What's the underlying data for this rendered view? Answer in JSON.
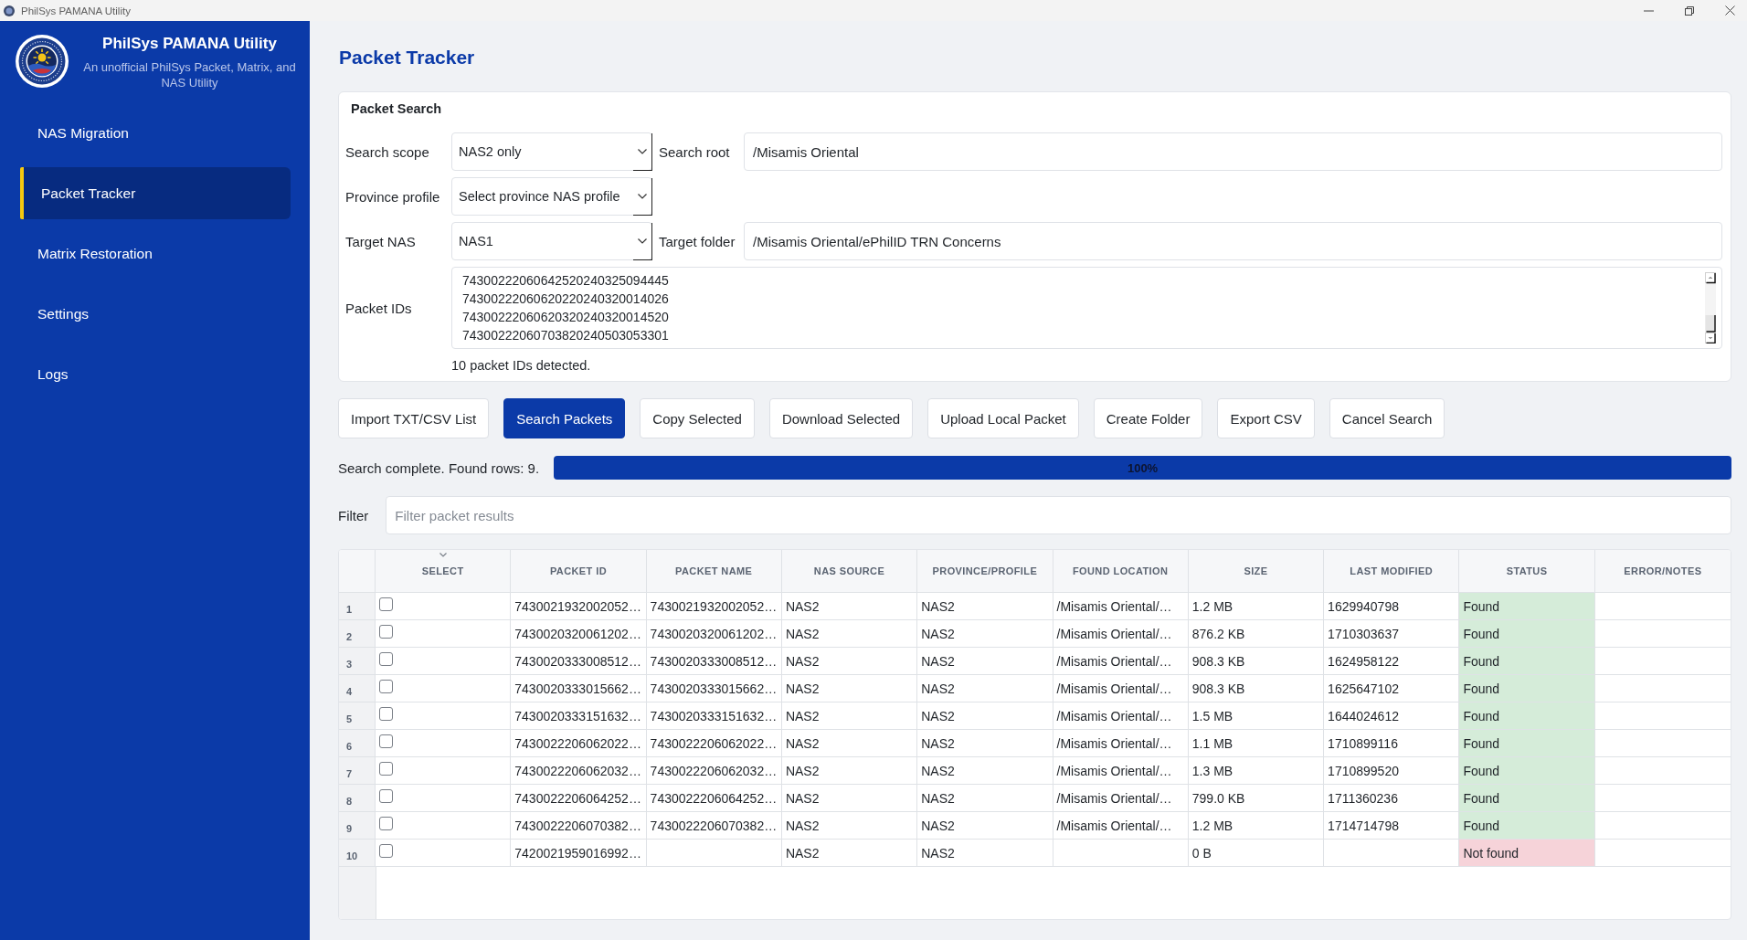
{
  "window": {
    "title": "PhilSys PAMANA Utility"
  },
  "sidebar": {
    "app_name": "PhilSys PAMANA Utility",
    "tagline": "An unofficial PhilSys Packet, Matrix, and NAS Utility",
    "items": [
      {
        "label": "NAS Migration",
        "selected": false
      },
      {
        "label": "Packet Tracker",
        "selected": true
      },
      {
        "label": "Matrix Restoration",
        "selected": false
      },
      {
        "label": "Settings",
        "selected": false
      },
      {
        "label": "Logs",
        "selected": false
      }
    ]
  },
  "page_title": "Packet Tracker",
  "packet_search": {
    "title": "Packet Search",
    "search_scope": {
      "label": "Search scope",
      "value": "NAS2 only"
    },
    "search_root": {
      "label": "Search root",
      "value": "/Misamis Oriental"
    },
    "province_profile": {
      "label": "Province profile",
      "value": "Select province NAS profile"
    },
    "target_nas": {
      "label": "Target NAS",
      "value": "NAS1"
    },
    "target_folder": {
      "label": "Target folder",
      "value": "/Misamis Oriental/ePhilID TRN Concerns"
    },
    "packet_ids": {
      "label": "Packet IDs",
      "lines": [
        "74300222060642520240325094445",
        "74300222060620220240320014026",
        "74300222060620320240320014520",
        "74300222060703820240503053301"
      ]
    },
    "detected_note": "10 packet IDs detected."
  },
  "actions": [
    {
      "label": "Import TXT/CSV List",
      "primary": false
    },
    {
      "label": "Search Packets",
      "primary": true
    },
    {
      "label": "Copy Selected",
      "primary": false
    },
    {
      "label": "Download Selected",
      "primary": false
    },
    {
      "label": "Upload Local Packet",
      "primary": false
    },
    {
      "label": "Create Folder",
      "primary": false
    },
    {
      "label": "Export CSV",
      "primary": false
    },
    {
      "label": "Cancel Search",
      "primary": false
    }
  ],
  "progress": {
    "message": "Search complete. Found rows: 9.",
    "level": 1,
    "label": "100%"
  },
  "filter": {
    "label": "Filter",
    "placeholder": "Filter packet results"
  },
  "results_table": {
    "columns": [
      {
        "label": "SELECT",
        "sorted": true
      },
      {
        "label": "PACKET ID",
        "sorted": false
      },
      {
        "label": "PACKET NAME",
        "sorted": false
      },
      {
        "label": "NAS SOURCE",
        "sorted": false
      },
      {
        "label": "PROVINCE/PROFILE",
        "sorted": false
      },
      {
        "label": "FOUND LOCATION",
        "sorted": false
      },
      {
        "label": "SIZE",
        "sorted": false
      },
      {
        "label": "LAST MODIFIED",
        "sorted": false
      },
      {
        "label": "STATUS",
        "sorted": false
      },
      {
        "label": "ERROR/NOTES",
        "sorted": false
      }
    ],
    "rows": [
      {
        "number": "1",
        "checked": false,
        "packet_id": "7430021932002052…",
        "packet_name": "7430021932002052…",
        "nas_source": "NAS2",
        "province_profile": "NAS2",
        "found_location": "/Misamis Oriental/…",
        "size": "1.2 MB",
        "last_modified": "1629940798",
        "status": {
          "text": "Found",
          "color": "#d5ecd9"
        }
      },
      {
        "number": "2",
        "checked": false,
        "packet_id": "7430020320061202…",
        "packet_name": "7430020320061202…",
        "nas_source": "NAS2",
        "province_profile": "NAS2",
        "found_location": "/Misamis Oriental/…",
        "size": "876.2 KB",
        "last_modified": "1710303637",
        "status": {
          "text": "Found",
          "color": "#d5ecd9"
        }
      },
      {
        "number": "3",
        "checked": false,
        "packet_id": "7430020333008512…",
        "packet_name": "7430020333008512…",
        "nas_source": "NAS2",
        "province_profile": "NAS2",
        "found_location": "/Misamis Oriental/…",
        "size": "908.3 KB",
        "last_modified": "1624958122",
        "status": {
          "text": "Found",
          "color": "#d5ecd9"
        }
      },
      {
        "number": "4",
        "checked": false,
        "packet_id": "7430020333015662…",
        "packet_name": "7430020333015662…",
        "nas_source": "NAS2",
        "province_profile": "NAS2",
        "found_location": "/Misamis Oriental/…",
        "size": "908.3 KB",
        "last_modified": "1625647102",
        "status": {
          "text": "Found",
          "color": "#d5ecd9"
        }
      },
      {
        "number": "5",
        "checked": false,
        "packet_id": "7430020333151632…",
        "packet_name": "7430020333151632…",
        "nas_source": "NAS2",
        "province_profile": "NAS2",
        "found_location": "/Misamis Oriental/…",
        "size": "1.5 MB",
        "last_modified": "1644024612",
        "status": {
          "text": "Found",
          "color": "#d5ecd9"
        }
      },
      {
        "number": "6",
        "checked": false,
        "packet_id": "7430022206062022…",
        "packet_name": "7430022206062022…",
        "nas_source": "NAS2",
        "province_profile": "NAS2",
        "found_location": "/Misamis Oriental/…",
        "size": "1.1 MB",
        "last_modified": "1710899116",
        "status": {
          "text": "Found",
          "color": "#d5ecd9"
        }
      },
      {
        "number": "7",
        "checked": false,
        "packet_id": "7430022206062032…",
        "packet_name": "7430022206062032…",
        "nas_source": "NAS2",
        "province_profile": "NAS2",
        "found_location": "/Misamis Oriental/…",
        "size": "1.3 MB",
        "last_modified": "1710899520",
        "status": {
          "text": "Found",
          "color": "#d5ecd9"
        }
      },
      {
        "number": "8",
        "checked": false,
        "packet_id": "7430022206064252…",
        "packet_name": "7430022206064252…",
        "nas_source": "NAS2",
        "province_profile": "NAS2",
        "found_location": "/Misamis Oriental/…",
        "size": "799.0 KB",
        "last_modified": "1711360236",
        "status": {
          "text": "Found",
          "color": "#d5ecd9"
        }
      },
      {
        "number": "9",
        "checked": false,
        "packet_id": "7430022206070382…",
        "packet_name": "7430022206070382…",
        "nas_source": "NAS2",
        "province_profile": "NAS2",
        "found_location": "/Misamis Oriental/…",
        "size": "1.2 MB",
        "last_modified": "1714714798",
        "status": {
          "text": "Found",
          "color": "#d5ecd9"
        }
      },
      {
        "number": "10",
        "checked": false,
        "packet_id": "7420021959016992…",
        "nas_source": "NAS2",
        "province_profile": "NAS2",
        "size": "0 B",
        "status": {
          "text": "Not found",
          "color": "#f6d3d9"
        }
      }
    ]
  }
}
